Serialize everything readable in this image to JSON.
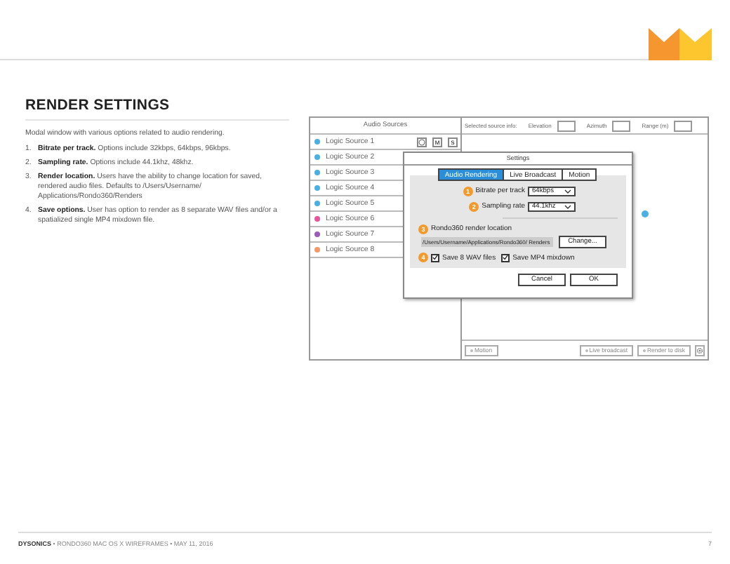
{
  "section": {
    "title": "RENDER SETTINGS",
    "intro": "Modal window with various options related to audio rendering.",
    "items": [
      {
        "number": "1.",
        "text": "**Bitrate per track.** Options include 32kbps, 64kbps, 96kbps."
      },
      {
        "number": "2.",
        "text": "**Sampling rate.** Options include 44.1khz, 48khz."
      },
      {
        "number": "3.",
        "text": "**Render location.** Users have the ability to change location for saved, rendered audio files. Defaults to /Users/Username/ Applications/Rondo360/Renders"
      },
      {
        "number": "4.",
        "text": "**Save options.** User has option to render as 8 separate WAV files and/or a spatialized single MP4 mixdown file."
      }
    ]
  },
  "wireframe": {
    "sources": {
      "header": "Audio Sources",
      "row_buttons": [
        "M",
        "S"
      ],
      "rows": [
        {
          "name": "Logic Source 1",
          "color": "#4ab0e4"
        },
        {
          "name": "Logic Source 2",
          "color": "#4ab0e4"
        },
        {
          "name": "Logic Source 3",
          "color": "#4ab0e4"
        },
        {
          "name": "Logic Source 4",
          "color": "#4ab0e4"
        },
        {
          "name": "Logic Source 5",
          "color": "#4ab0e4"
        },
        {
          "name": "Logic Source 6",
          "color": "#e8559c"
        },
        {
          "name": "Logic Source 7",
          "color": "#9b5bb8"
        },
        {
          "name": "Logic Source 8",
          "color": "#f39a6a"
        }
      ]
    },
    "info": {
      "label": "Selected source info:",
      "fields": [
        "Elevation",
        "Azimuth",
        "Range (m)"
      ]
    },
    "bottom_buttons": [
      "Motion",
      "Live broadcast",
      "Render to disk"
    ],
    "dialog": {
      "title": "Settings",
      "tabs": [
        {
          "label": "Audio Rendering",
          "selected": true
        },
        {
          "label": "Live Broadcast",
          "selected": false
        },
        {
          "label": "Motion",
          "selected": false
        }
      ],
      "bitrate": {
        "badge": "1",
        "label": "Bitrate per track",
        "value": "64kbps"
      },
      "sampling": {
        "badge": "2",
        "label": "Sampling rate",
        "value": "44.1khz"
      },
      "location": {
        "badge": "3",
        "label": "Rondo360 render location",
        "path": "/Users/Username/Applications/Rondo360/ Renders",
        "button": "Change..."
      },
      "save": {
        "badge": "4",
        "options": [
          {
            "label": "Save 8 WAV files",
            "checked": true
          },
          {
            "label": "Save MP4 mixdown",
            "checked": true
          }
        ]
      },
      "buttons": [
        "Cancel",
        "OK"
      ]
    }
  },
  "footer": {
    "brand": "DYSONICS",
    "text": "• RONDO360 MAC OS X WIREFRAMES • MAY 11, 2016",
    "page": "7"
  }
}
